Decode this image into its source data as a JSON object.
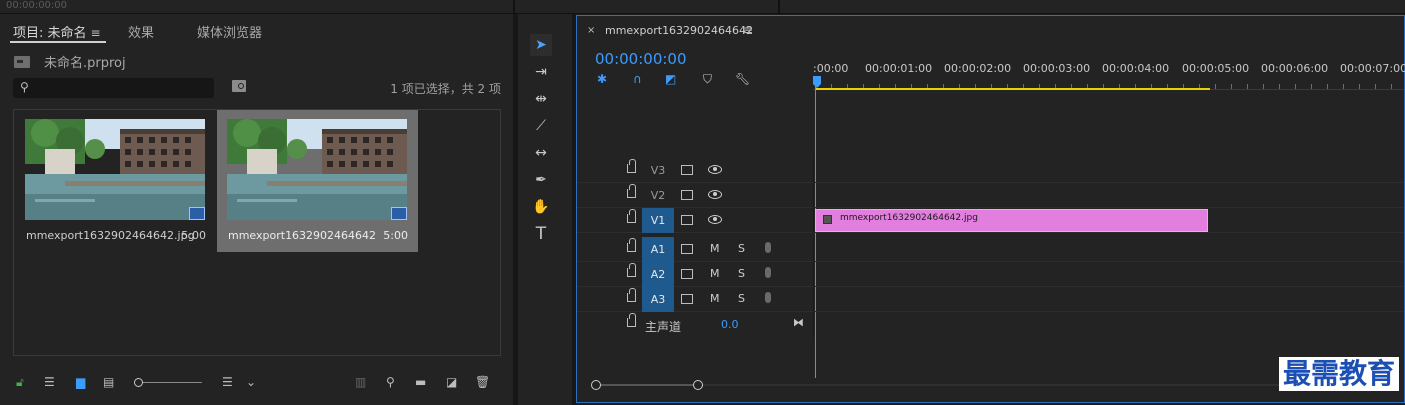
{
  "top": {
    "timecode": "00:00:00:00"
  },
  "project": {
    "tabs": [
      {
        "label": "项目: 未命名",
        "menu": "≡"
      },
      {
        "label": "效果"
      },
      {
        "label": "媒体浏览器"
      }
    ],
    "project_file": "未命名.prproj",
    "search": {
      "placeholder": "",
      "value": ""
    },
    "selection_status": "1 项已选择，共 2 项",
    "items": [
      {
        "name": "mmexport1632902464642.jpg",
        "duration": "5:00",
        "selected": false
      },
      {
        "name": "mmexport1632902464642",
        "duration": "5:00",
        "selected": true
      }
    ],
    "footer_icons": [
      "lock-icon",
      "list-view-icon",
      "icon-view-icon",
      "freeform-view-icon",
      "zoom-slider",
      "sort-icon",
      "automate-icon",
      "find-icon",
      "new-bin-icon",
      "new-item-icon",
      "trash-icon"
    ]
  },
  "tools": [
    "selection-tool",
    "track-select-tool",
    "ripple-edit-tool",
    "razor-tool",
    "slip-tool",
    "pen-tool",
    "hand-tool",
    "type-tool"
  ],
  "timeline": {
    "sequence_name": "mmexport1632902464642",
    "menu": "≡",
    "close": "×",
    "timecode": "00:00:00:00",
    "ruler_labels": [
      ":00:00",
      "00:00:01:00",
      "00:00:02:00",
      "00:00:03:00",
      "00:00:04:00",
      "00:00:05:00",
      "00:00:06:00",
      "00:00:07:00"
    ],
    "video_tracks": [
      {
        "label": "V3",
        "targeted": false
      },
      {
        "label": "V2",
        "targeted": false
      },
      {
        "label": "V1",
        "targeted": true,
        "clip": "mmexport1632902464642.jpg"
      }
    ],
    "audio_tracks": [
      {
        "label": "A1",
        "m": "M",
        "s": "S"
      },
      {
        "label": "A2",
        "m": "M",
        "s": "S"
      },
      {
        "label": "A3",
        "m": "M",
        "s": "S"
      }
    ],
    "master": {
      "label": "主声道",
      "value": "0.0"
    }
  },
  "watermark": "最需教育",
  "colors": {
    "accent": "#3d9bff",
    "clip": "#e27fde",
    "work_area": "#e6d200",
    "track_target": "#1f5a8e"
  }
}
